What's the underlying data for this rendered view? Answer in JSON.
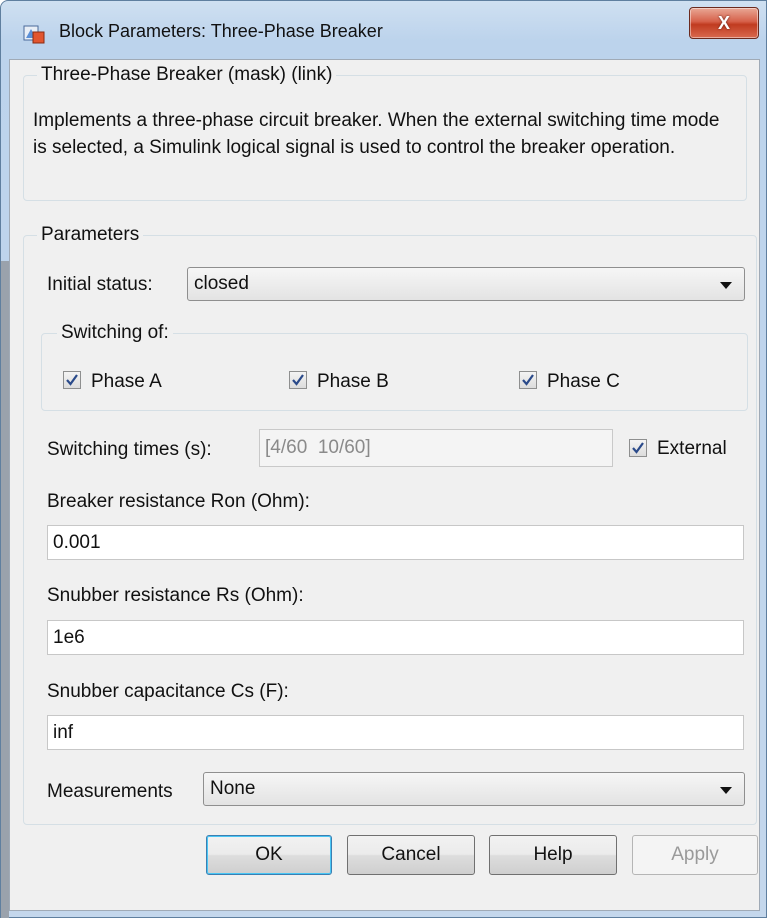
{
  "window": {
    "title": "Block Parameters: Three-Phase Breaker",
    "close_glyph": "X",
    "title_icon": "simulink-block-icon"
  },
  "mask": {
    "legend": "Three-Phase Breaker (mask) (link)",
    "description": "Implements a three-phase circuit breaker. When the external switching time mode is selected, a Simulink logical signal is used to control the breaker operation."
  },
  "parameters": {
    "legend": "Parameters",
    "initial_status": {
      "label": "Initial status:",
      "value": "closed"
    },
    "switching_of": {
      "legend": "Switching of:",
      "phases": [
        {
          "label": "Phase A",
          "checked": true
        },
        {
          "label": "Phase B",
          "checked": true
        },
        {
          "label": "Phase C",
          "checked": true
        }
      ]
    },
    "switching_times": {
      "label": "Switching times (s):",
      "value": "[4/60  10/60]",
      "enabled": false
    },
    "external": {
      "label": "External",
      "checked": true
    },
    "ron": {
      "label": "Breaker resistance Ron (Ohm):",
      "value": "0.001"
    },
    "rs": {
      "label": "Snubber resistance Rs (Ohm):",
      "value": "1e6"
    },
    "cs": {
      "label": "Snubber capacitance Cs (F):",
      "value": "inf"
    },
    "measurements": {
      "label": "Measurements",
      "value": "None"
    }
  },
  "buttons": {
    "ok": "OK",
    "cancel": "Cancel",
    "help": "Help",
    "apply": "Apply"
  },
  "colors": {
    "close_button": "#c8452a",
    "default_button_glow": "#48c6f5",
    "check_mark": "#2a4a8a"
  }
}
